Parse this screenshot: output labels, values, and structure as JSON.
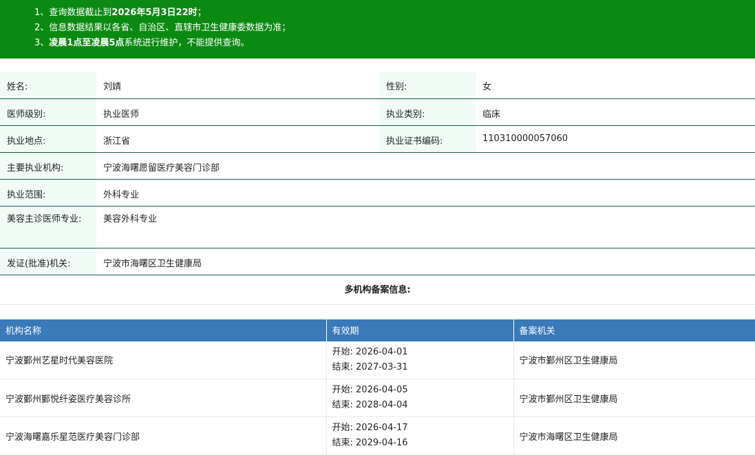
{
  "notice": {
    "line1_prefix": "1、查询数据截止到",
    "line1_bold": "2026年5月3日22时",
    "line1_suffix": "；",
    "line2": "2、信息数据结果以各省、自治区、直辖市卫生健康委数据为准；",
    "line3_prefix": "3、",
    "line3_bold": "凌晨1点至凌晨5点",
    "line3_suffix": "系统进行维护，不能提供查询。"
  },
  "doctor": {
    "name_label": "姓名:",
    "name": "刘婧",
    "gender_label": "性别:",
    "gender": "女",
    "level_label": "医师级别:",
    "level": "执业医师",
    "category_label": "执业类别:",
    "category": "临床",
    "location_label": "执业地点:",
    "location": "浙江省",
    "cert_label": "执业证书编码:",
    "cert": "110310000057060",
    "institution_label": "主要执业机构:",
    "institution": "宁波海曙愿留医疗美容门诊部",
    "scope_label": "执业范围:",
    "scope": "外科专业",
    "cosmetic_label": "美容主诊医师专业:",
    "cosmetic": "美容外科专业",
    "issuer_label": "发证(批准)机关:",
    "issuer": "宁波市海曙区卫生健康局"
  },
  "multi_title": "多机构备案信息:",
  "records": {
    "headers": [
      "机构名称",
      "有效期",
      "备案机关"
    ],
    "start_prefix": "开始:",
    "end_prefix": "结束:",
    "rows": [
      {
        "name": "宁波鄞州艺星时代美容医院",
        "start": "2026-04-01",
        "end": "2027-03-31",
        "authority": "宁波市鄞州区卫生健康局"
      },
      {
        "name": "宁波鄞州鄞悦纤姿医疗美容诊所",
        "start": "2026-04-05",
        "end": "2028-04-04",
        "authority": "宁波市鄞州区卫生健康局"
      },
      {
        "name": "宁波海曙嘉乐星范医疗美容门诊部",
        "start": "2026-04-17",
        "end": "2029-04-16",
        "authority": "宁波市海曙区卫生健康局"
      }
    ]
  }
}
